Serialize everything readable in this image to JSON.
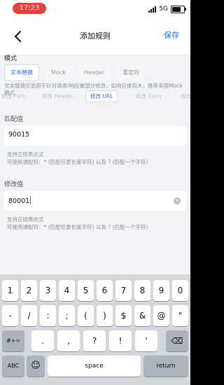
{
  "status": {
    "time": "17:23",
    "network": "5G",
    "signal_bars": 4
  },
  "navbar": {
    "title": "添加规则",
    "save_label": "保存",
    "back_icon": "chevron-left-icon"
  },
  "mode": {
    "section_label": "模式",
    "options": [
      "文本替换",
      "Mock",
      "Header",
      "重定向"
    ],
    "selected": "文本替换"
  },
  "hint": "文本替换仅适用于针对请求/响应做部分修改，如响应体较大，推荐采用Mock模式",
  "subtabs": {
    "items": [
      "修改 Path",
      "修改 Header",
      "修改 URL",
      "修改 Form",
      "修改"
    ],
    "selected": "修改 URL"
  },
  "match": {
    "label": "匹配值",
    "value": "90015",
    "note_line1": "支持正则表达式",
    "note_line2": "可使用通配符：* (匹配任意长度字符) 以及 ? (匹配一个字符)"
  },
  "replace": {
    "label": "修改值",
    "value": "80001",
    "note_line1": "支持正则表达式",
    "note_line2": "可使用通配符：* (匹配任意长度字符) 以及 ? (匹配一个字符)"
  },
  "keyboard": {
    "row1": [
      "1",
      "2",
      "3",
      "4",
      "5",
      "6",
      "7",
      "8",
      "9",
      "0"
    ],
    "row2": [
      "-",
      "/",
      ":",
      ";",
      "(",
      ")",
      "$",
      "&",
      "@",
      "\""
    ],
    "row3_left": "#+=",
    "row3": [
      ".",
      ",",
      "?",
      "!",
      "'"
    ],
    "row3_right": "⌫",
    "abc": "ABC",
    "emoji": "☺",
    "space": "space",
    "return": "return"
  }
}
